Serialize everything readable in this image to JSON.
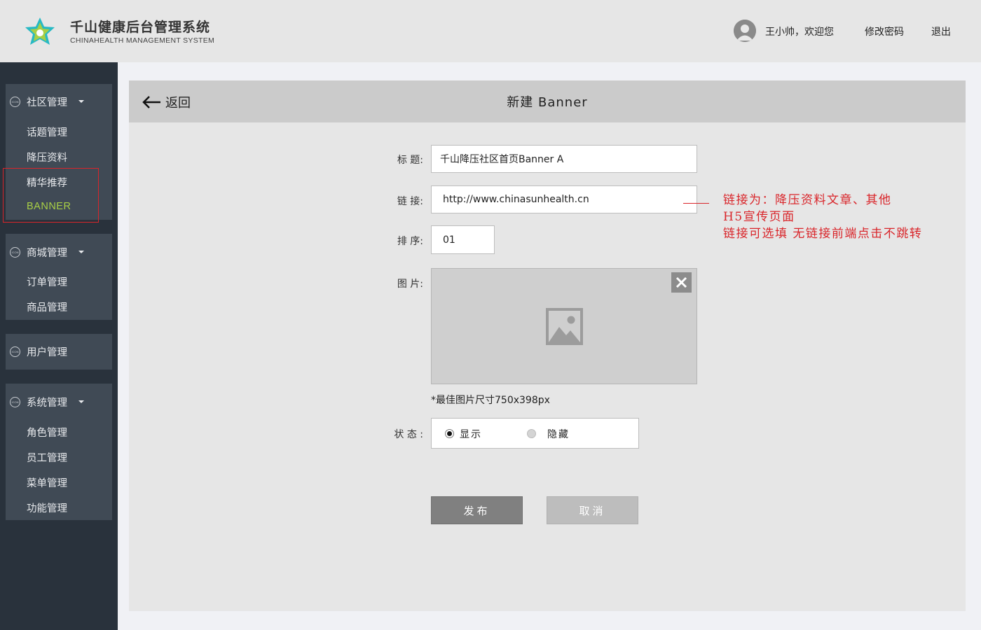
{
  "header": {
    "brand_title": "千山健康后台管理系统",
    "brand_subtitle": "CHINAHEALTH  MANAGEMENT SYSTEM",
    "welcome": "王小帅，欢迎您",
    "change_password": "修改密码",
    "logout": "退出"
  },
  "sidebar": {
    "group_icon_text": "ICON",
    "groups": [
      {
        "label": "社区管理",
        "items": [
          "话题管理",
          "降压资料",
          "精华推荐",
          "BANNER"
        ]
      },
      {
        "label": "商城管理",
        "items": [
          "订单管理",
          "商品管理"
        ]
      },
      {
        "label": "用户管理",
        "items": []
      },
      {
        "label": "系统管理",
        "items": [
          "角色管理",
          "员工管理",
          "菜单管理",
          "功能管理"
        ]
      }
    ],
    "active_item": "BANNER"
  },
  "page": {
    "back_label": "返回",
    "title": "新建 Banner"
  },
  "form": {
    "title_label": "标 题:",
    "title_value": "千山降压社区首页Banner A",
    "link_label": "链 接:",
    "link_value": "http://www.chinasunhealth.cn",
    "order_label": "排 序:",
    "order_value": "01",
    "image_label": "图 片:",
    "image_hint": "*最佳图片尺寸750x398px",
    "status_label": "状 态 :",
    "status_options": [
      "显示",
      "隐藏"
    ],
    "status_selected": "显示",
    "publish_label": "发布",
    "cancel_label": "取消"
  },
  "annotation": {
    "lines": [
      "链接为：降压资料文章、其他",
      "H5宣传页面",
      "链接可选填 无链接前端点击不跳转"
    ],
    "color": "#d9252a"
  },
  "colors": {
    "sidebar_bg": "#29323c",
    "nav_group_bg": "#404a55",
    "active_item": "#a8cf45",
    "logo_green": "#a8cf45",
    "logo_teal": "#27b9c4"
  }
}
